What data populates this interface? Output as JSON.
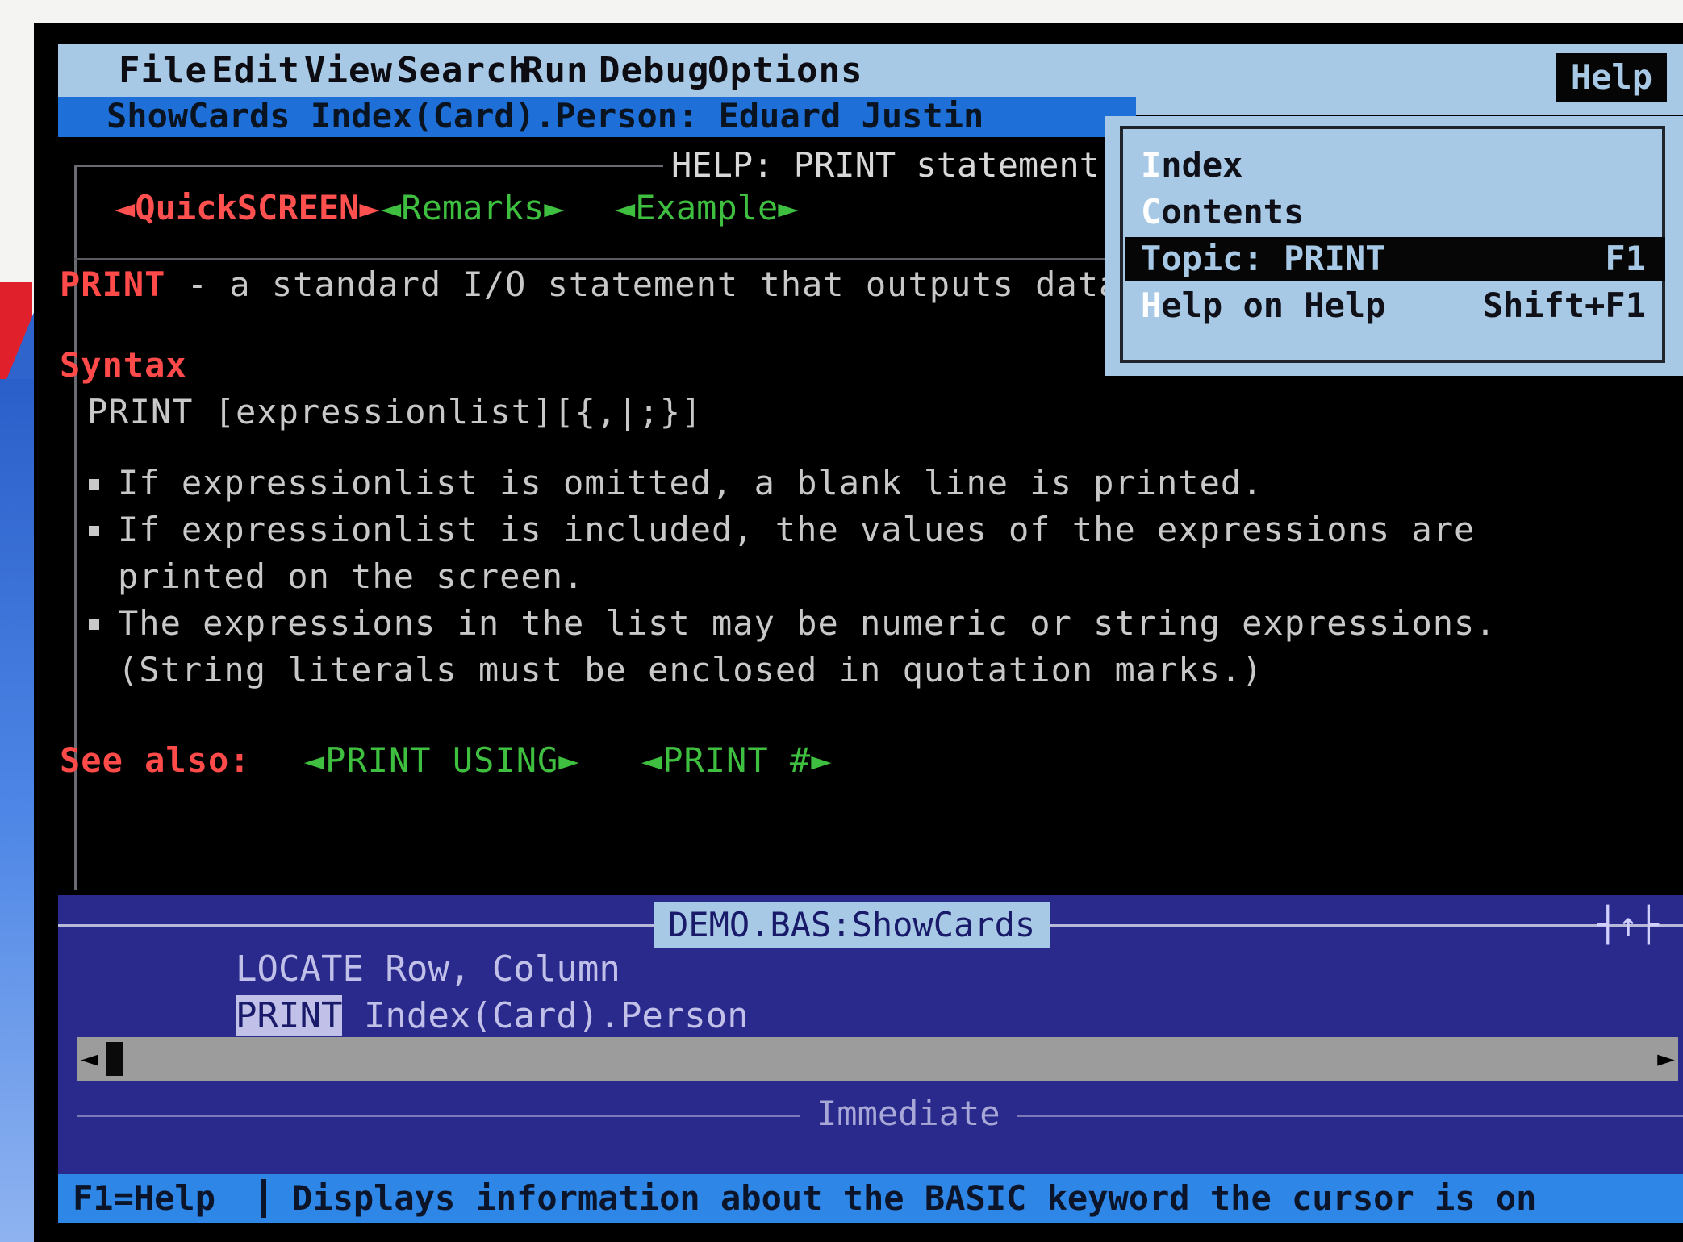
{
  "menu": {
    "items": [
      "File",
      "Edit",
      "View",
      "Search",
      "Run",
      "Debug",
      "Options"
    ],
    "help": "Help"
  },
  "titlebar": "ShowCards Index(Card).Person: Eduard Justin",
  "help_window": {
    "title": "HELP: PRINT statement",
    "tabs": [
      "◄QuickSCREEN►",
      "◄Remarks►",
      "◄Example►"
    ],
    "keyword": "PRINT",
    "description": " - a standard I/O statement that outputs data",
    "syntax_label": "Syntax",
    "syntax": "PRINT [expressionlist][{,|;}]",
    "bullets": [
      "If expressionlist is omitted, a blank line is printed.",
      "If expressionlist is included, the values of the expressions are",
      "The expressions in the list may be numeric or string expressions."
    ],
    "bullet_continuations": [
      "printed on the screen.",
      "(String literals must be enclosed in quotation marks.)"
    ],
    "see_also_label": "See also:",
    "see_also": [
      "◄PRINT USING►",
      "◄PRINT #►"
    ]
  },
  "help_menu": {
    "items": [
      {
        "accel": "I",
        "rest": "ndex",
        "shortcut": ""
      },
      {
        "accel": "C",
        "rest": "ontents",
        "shortcut": ""
      },
      {
        "accel": "T",
        "rest": "opic: PRINT",
        "shortcut": "F1"
      },
      {
        "accel": "H",
        "rest": "elp on Help",
        "shortcut": "Shift+F1"
      }
    ],
    "selected_index": 2
  },
  "code_window": {
    "title": "DEMO.BAS:ShowCards",
    "max_button": "┤↑├",
    "line1": "LOCATE Row, Column",
    "line2_kw": "PRINT",
    "line2_rest": " Index(Card).Person"
  },
  "immediate": {
    "title": "Immediate"
  },
  "statusbar": {
    "key": "F1=Help",
    "message": "Displays information about the BASIC keyword the cursor is on"
  },
  "colors": {
    "menu_bg": "#a8c9e6",
    "titlebar_bg": "#1e6fd8",
    "code_bg": "#2a2a8c",
    "status_bg": "#2e86e6",
    "help_red": "#ff4a4a",
    "help_green": "#3fbf3f"
  }
}
